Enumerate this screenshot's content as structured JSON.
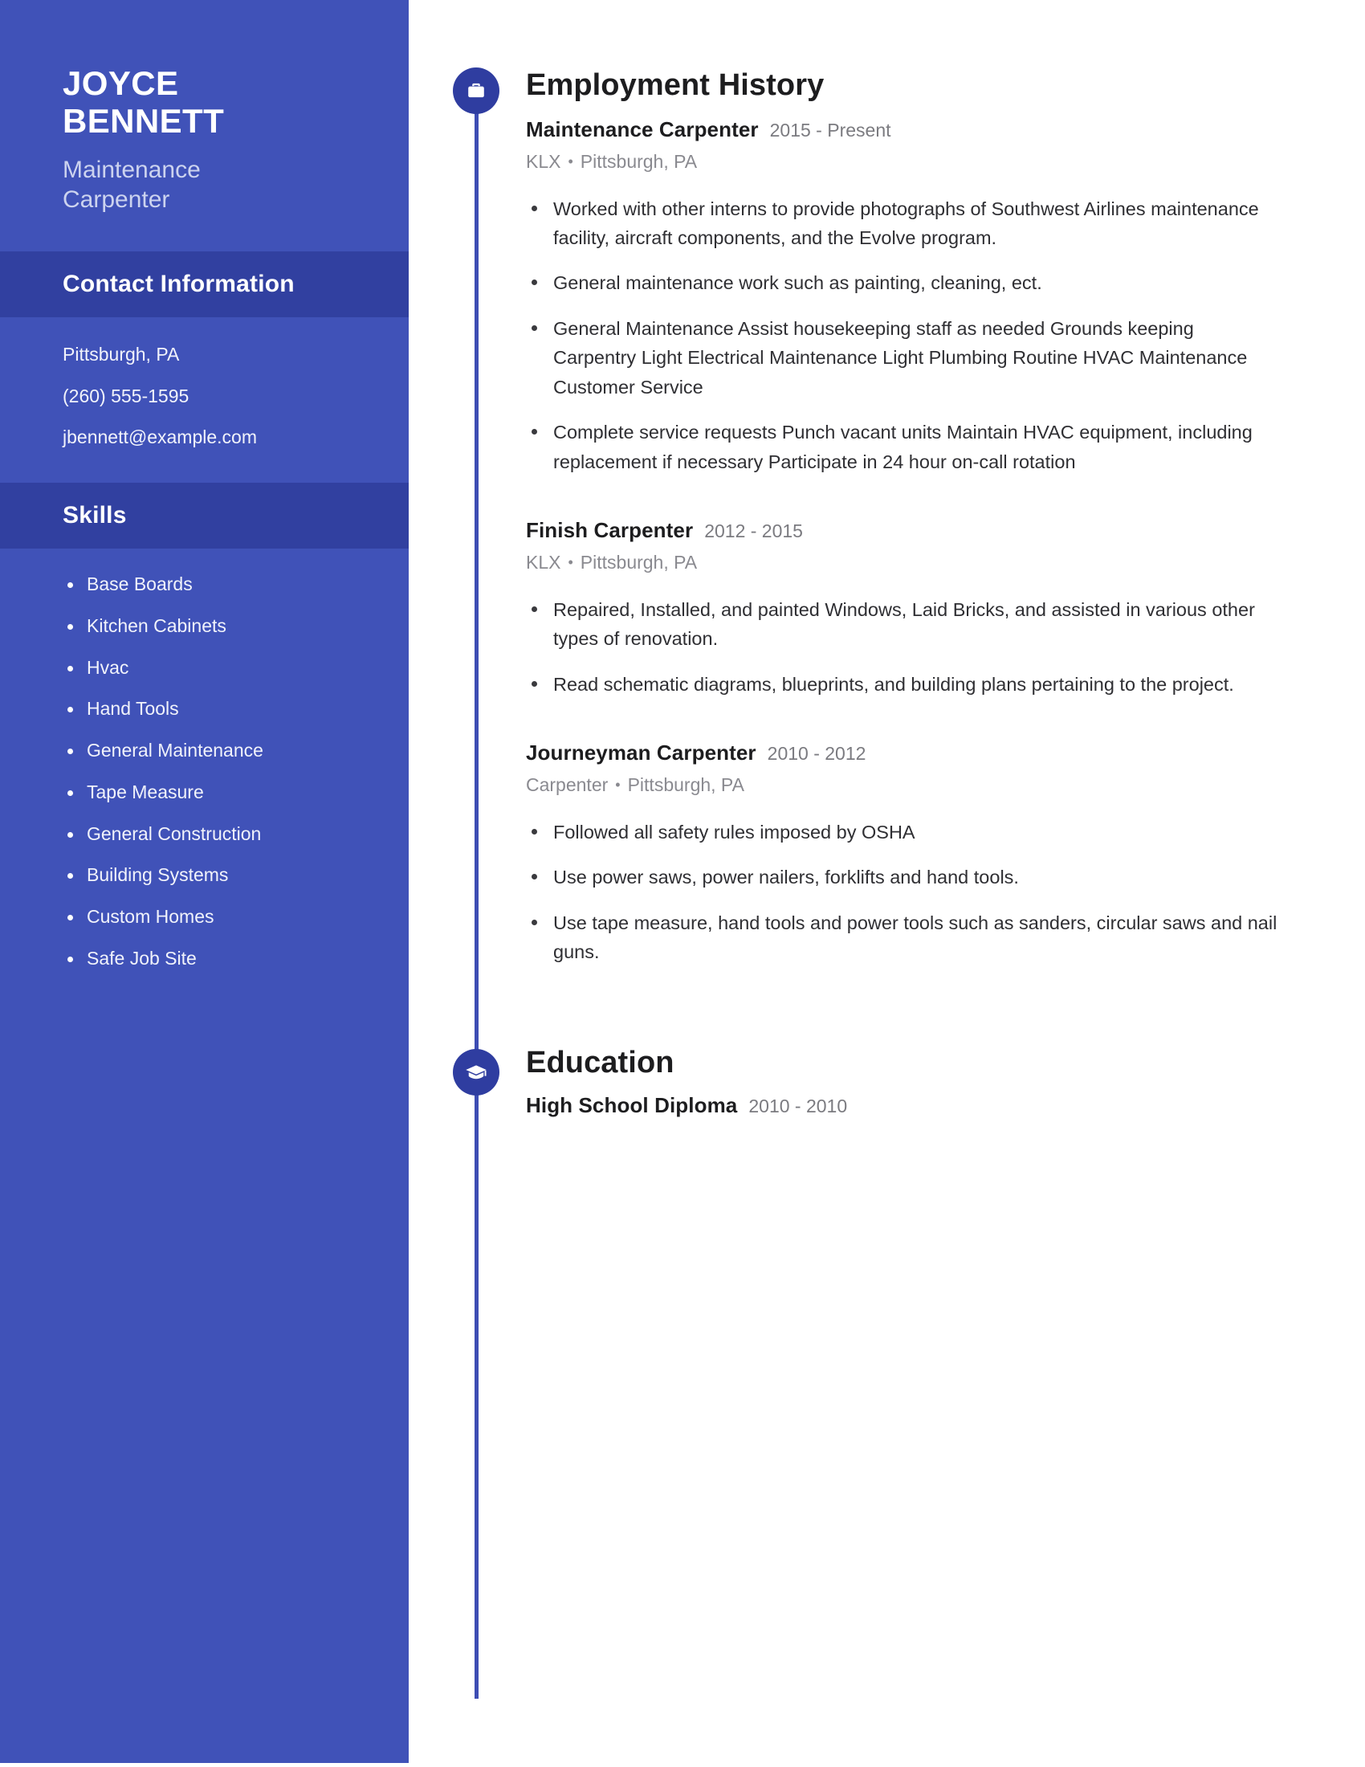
{
  "theme": {
    "sidebar_bg": "#4052b8",
    "sidebar_band_bg": "#3140a0",
    "accent_dot": "#2f3da0",
    "timeline_line": "#3d4db3",
    "page_bg": "#ffffff",
    "heading_text": "#1d1d1f",
    "muted_text": "#8a8a90"
  },
  "sidebar": {
    "name_line1": "JOYCE",
    "name_line2": "BENNETT",
    "job_title": "Maintenance Carpenter",
    "contact": {
      "heading": "Contact Information",
      "items": [
        "Pittsburgh, PA",
        "(260) 555-1595",
        "jbennett@example.com"
      ]
    },
    "skills": {
      "heading": "Skills",
      "items": [
        "Base Boards",
        "Kitchen Cabinets",
        "Hvac",
        "Hand Tools",
        "General Maintenance",
        "Tape Measure",
        "General Construction",
        "Building Systems",
        "Custom Homes",
        "Safe Job Site"
      ]
    }
  },
  "main": {
    "employment": {
      "icon": "briefcase-icon",
      "heading": "Employment History",
      "entries": [
        {
          "role": "Maintenance Carpenter",
          "dates": "2015 - Present",
          "company": "KLX",
          "location": "Pittsburgh, PA",
          "bullets": [
            "Worked with other interns to provide photographs of Southwest Airlines maintenance facility, aircraft components, and the Evolve program.",
            "General maintenance work such as painting, cleaning, ect.",
            "General Maintenance Assist housekeeping staff as needed Grounds keeping Carpentry Light Electrical Maintenance Light Plumbing Routine HVAC Maintenance Customer Service",
            "Complete service requests Punch vacant units Maintain HVAC equipment, including replacement if necessary Participate in 24 hour on-call rotation"
          ]
        },
        {
          "role": "Finish Carpenter",
          "dates": "2012 - 2015",
          "company": "KLX",
          "location": "Pittsburgh, PA",
          "bullets": [
            "Repaired, Installed, and painted Windows, Laid Bricks, and assisted in various other types of renovation.",
            "Read schematic diagrams, blueprints, and building plans pertaining to the project."
          ]
        },
        {
          "role": "Journeyman Carpenter",
          "dates": "2010 - 2012",
          "company": "Carpenter",
          "location": "Pittsburgh, PA",
          "bullets": [
            "Followed all safety rules imposed by OSHA",
            "Use power saws, power nailers, forklifts and hand tools.",
            "Use tape measure, hand tools and power tools such as sanders, circular saws and nail guns."
          ]
        }
      ]
    },
    "education": {
      "icon": "graduation-cap-icon",
      "heading": "Education",
      "entries": [
        {
          "degree": "High School Diploma",
          "dates": "2010 - 2010"
        }
      ]
    }
  }
}
